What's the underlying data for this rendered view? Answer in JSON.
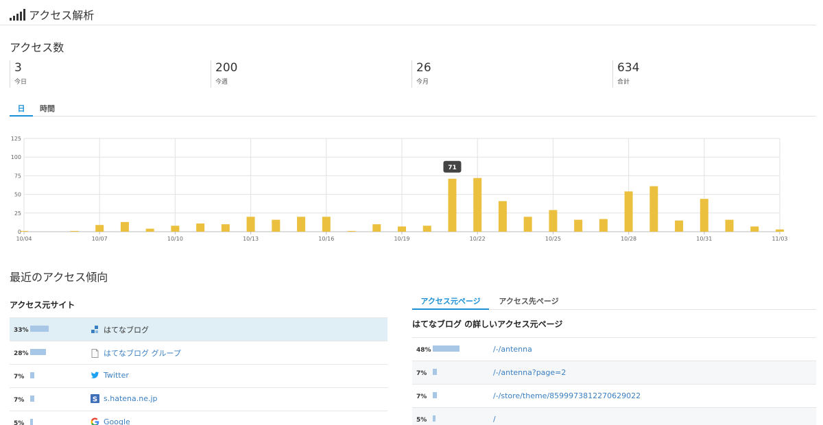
{
  "header": {
    "title": "アクセス解析",
    "icon": "signal-bars-icon"
  },
  "access": {
    "title": "アクセス数",
    "stats": [
      {
        "value": "3",
        "label": "今日"
      },
      {
        "value": "200",
        "label": "今週"
      },
      {
        "value": "26",
        "label": "今月"
      },
      {
        "value": "634",
        "label": "合計"
      }
    ],
    "tabs": [
      {
        "label": "日",
        "active": true
      },
      {
        "label": "時間",
        "active": false
      }
    ]
  },
  "chart_data": {
    "type": "bar",
    "ylim": [
      0,
      125
    ],
    "yticks": [
      0,
      25,
      50,
      75,
      100,
      125
    ],
    "xtick_labels": [
      "10/04",
      "10/07",
      "10/10",
      "10/13",
      "10/16",
      "10/19",
      "10/22",
      "10/25",
      "10/28",
      "10/31",
      "11/03"
    ],
    "categories": [
      "10/04",
      "10/05",
      "10/06",
      "10/07",
      "10/08",
      "10/09",
      "10/10",
      "10/11",
      "10/12",
      "10/13",
      "10/14",
      "10/15",
      "10/16",
      "10/17",
      "10/18",
      "10/19",
      "10/20",
      "10/21",
      "10/22",
      "10/23",
      "10/24",
      "10/25",
      "10/26",
      "10/27",
      "10/28",
      "10/29",
      "10/30",
      "10/31",
      "11/01",
      "11/02",
      "11/03"
    ],
    "values": [
      1,
      0,
      1,
      9,
      13,
      4,
      8,
      11,
      10,
      20,
      16,
      20,
      20,
      1,
      10,
      7,
      8,
      71,
      72,
      41,
      20,
      29,
      16,
      17,
      54,
      61,
      15,
      44,
      16,
      7,
      3
    ],
    "tooltip": {
      "category": "10/21",
      "value": "71"
    },
    "bar_color": "#ebc03f",
    "grid": true
  },
  "trends": {
    "title": "最近のアクセス傾向",
    "sources": {
      "title": "アクセス元サイト",
      "rows": [
        {
          "percent": "33%",
          "share": 0.33,
          "name": "はてなブログ",
          "icon": "hatena-blog-icon",
          "selected": true
        },
        {
          "percent": "28%",
          "share": 0.28,
          "name": "はてなブログ グループ",
          "icon": "document-icon",
          "selected": false
        },
        {
          "percent": "7%",
          "share": 0.07,
          "name": "Twitter",
          "icon": "twitter-icon",
          "selected": false
        },
        {
          "percent": "7%",
          "share": 0.07,
          "name": "s.hatena.ne.jp",
          "icon": "hatena-star-icon",
          "selected": false
        },
        {
          "percent": "5%",
          "share": 0.05,
          "name": "Google",
          "icon": "google-icon",
          "selected": false
        }
      ]
    },
    "pages": {
      "tabs": [
        {
          "label": "アクセス元ページ",
          "active": true
        },
        {
          "label": "アクセス先ページ",
          "active": false
        }
      ],
      "title": "はてなブログ の詳しいアクセス元ページ",
      "rows": [
        {
          "percent": "48%",
          "share": 0.48,
          "path": "/-/antenna"
        },
        {
          "percent": "7%",
          "share": 0.07,
          "path": "/-/antenna?page=2"
        },
        {
          "percent": "7%",
          "share": 0.07,
          "path": "/-/store/theme/8599973812270629022"
        },
        {
          "percent": "5%",
          "share": 0.05,
          "path": "/"
        }
      ]
    }
  }
}
